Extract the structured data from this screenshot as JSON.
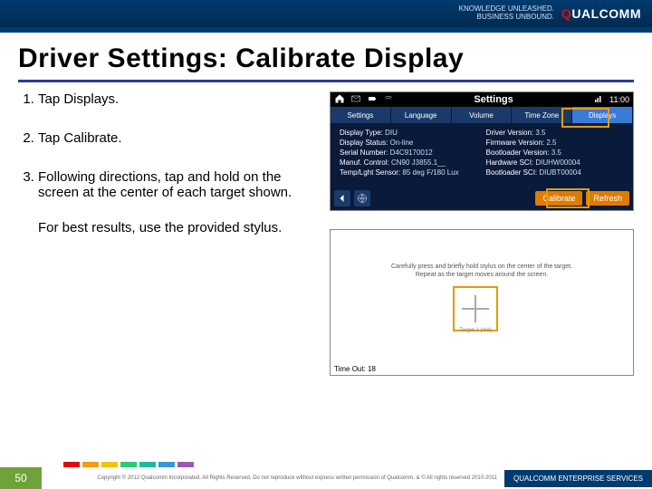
{
  "header": {
    "tagline_l1": "KNOWLEDGE UNLEASHED.",
    "tagline_l2": "BUSINESS UNBOUND.",
    "brand": "QUALCOMM"
  },
  "title": "Driver Settings: Calibrate Display",
  "steps": {
    "s1": "Tap Displays.",
    "s2": "Tap Calibrate.",
    "s3": "Following directions, tap and hold on the screen at the center of each target shown.",
    "note": "For best results, use the provided stylus."
  },
  "settings_shot": {
    "title": "Settings",
    "time": "11:00",
    "tabs": [
      "Settings",
      "Language",
      "Volume",
      "Time Zone",
      "Displays"
    ],
    "left": [
      {
        "k": "Display Type:",
        "v": "DIU"
      },
      {
        "k": "Display Status:",
        "v": "On-line"
      },
      {
        "k": "Serial Number:",
        "v": "D4C9170012"
      },
      {
        "k": "Manuf. Control:",
        "v": "CN90 J3855.1__"
      },
      {
        "k": "Temp/Lght Sensor:",
        "v": "85 deg F/180 Lux"
      }
    ],
    "right": [
      {
        "k": "Driver Version:",
        "v": "3.5"
      },
      {
        "k": "Firmware Version:",
        "v": "2.5"
      },
      {
        "k": "Bootloader Version:",
        "v": "3.5"
      },
      {
        "k": "Hardware SCI:",
        "v": "DIUHW00004"
      },
      {
        "k": "Bootloader SCI:",
        "v": "DIUBT00004"
      }
    ],
    "btn_cal": "Calibrate",
    "btn_ref": "Refresh"
  },
  "cal_shot": {
    "line1": "Carefully press and briefly hold stylus on the center of the target.",
    "line2": "Repeat as the target moves around the screen.",
    "target_label": "Target 1 (dot)",
    "timeout": "Time Out: 18"
  },
  "footer": {
    "page": "50",
    "copyright": "Copyright © 2012 Qualcomm Incorporated. All Rights Reserved. Do not reproduce without express written permission of Qualcomm. & © All rights reserved 2010-2011",
    "brand": "QUALCOMM ENTERPRISE SERVICES"
  },
  "chip_colors": [
    "#e30613",
    "#f39c12",
    "#f1c40f",
    "#2ecc71",
    "#1abc9c",
    "#3498db",
    "#9b59b6"
  ]
}
